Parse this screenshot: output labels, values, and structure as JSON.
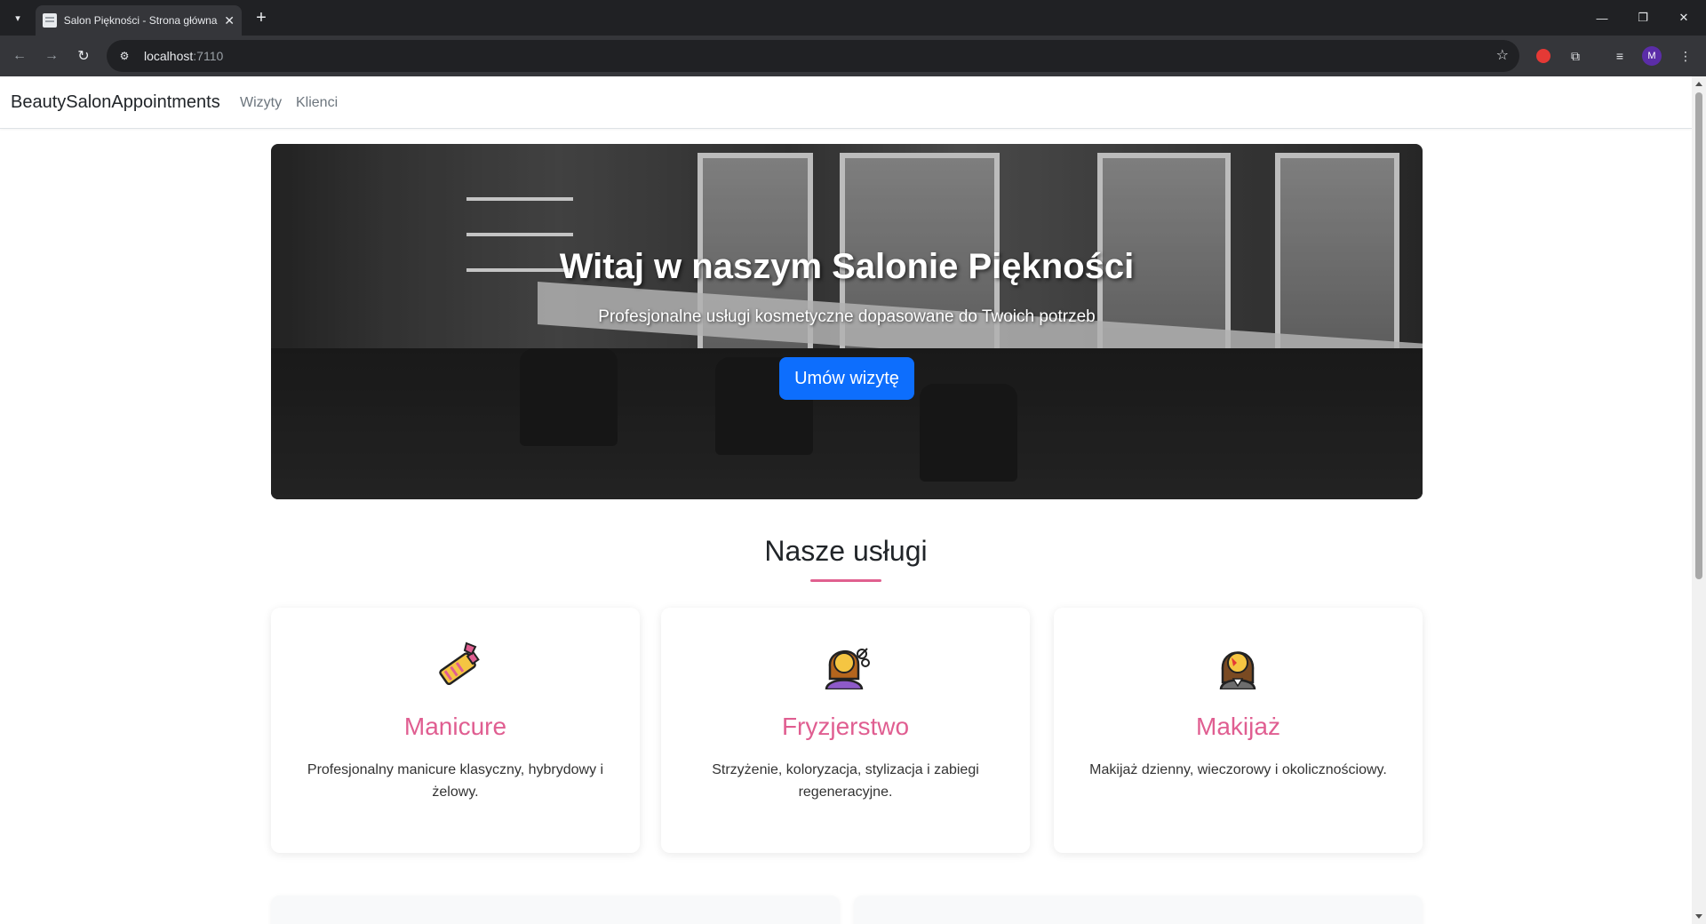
{
  "browser": {
    "tab_title": "Salon Piękności - Strona główna",
    "url_host": "localhost",
    "url_port": ":7110",
    "avatar_letter": "M"
  },
  "navbar": {
    "brand": "BeautySalonAppointments",
    "links": [
      "Wizyty",
      "Klienci"
    ]
  },
  "hero": {
    "title": "Witaj w naszym Salonie Piękności",
    "subtitle": "Profesjonalne usługi kosmetyczne dopasowane do Twoich potrzeb",
    "button_label": "Umów wizytę"
  },
  "services": {
    "heading": "Nasze usługi",
    "accent_color": "#e05e91",
    "items": [
      {
        "icon": "nail-polish-icon",
        "title": "Manicure",
        "text": "Profesjonalny manicure klasyczny, hybrydowy i żelowy."
      },
      {
        "icon": "haircut-icon",
        "title": "Fryzjerstwo",
        "text": "Strzyżenie, koloryzacja, stylizacja i zabiegi regeneracyjne."
      },
      {
        "icon": "makeup-icon",
        "title": "Makijaż",
        "text": "Makijaż dzienny, wieczorowy i okolicznościowy."
      }
    ]
  },
  "colors": {
    "primary_button": "#0d6efd",
    "chrome_dark": "#202124",
    "chrome_toolbar": "#35363a"
  }
}
